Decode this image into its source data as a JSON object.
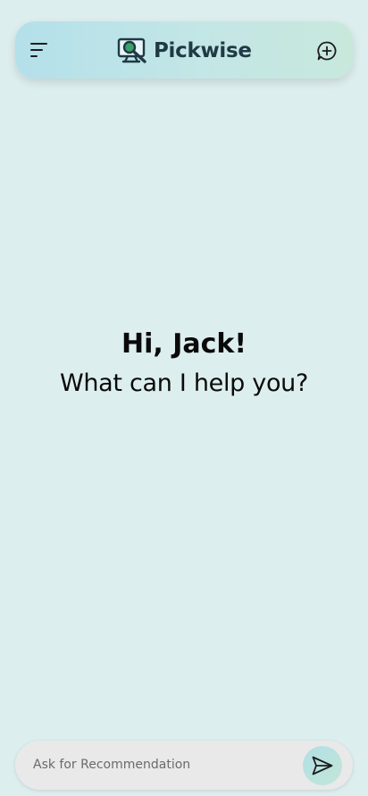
{
  "header": {
    "menu_icon": "sort-lines-icon",
    "logo_icon": "monitor-magnifier-icon",
    "app_name": "Pickwise",
    "new_chat_icon": "chat-plus-icon"
  },
  "greeting": {
    "title": "Hi, Jack!",
    "subtitle": "What can I help you?"
  },
  "composer": {
    "placeholder": "Ask for Recommendation",
    "value": "",
    "send_icon": "send-arrow-icon"
  },
  "colors": {
    "background": "#ddeeee",
    "header_gradient_start": "#b4e0ea",
    "header_gradient_end": "#c8e8dc",
    "brand_text": "#1f3a44",
    "logo_accent": "#3aa36a",
    "input_background": "#e9e9e9"
  }
}
